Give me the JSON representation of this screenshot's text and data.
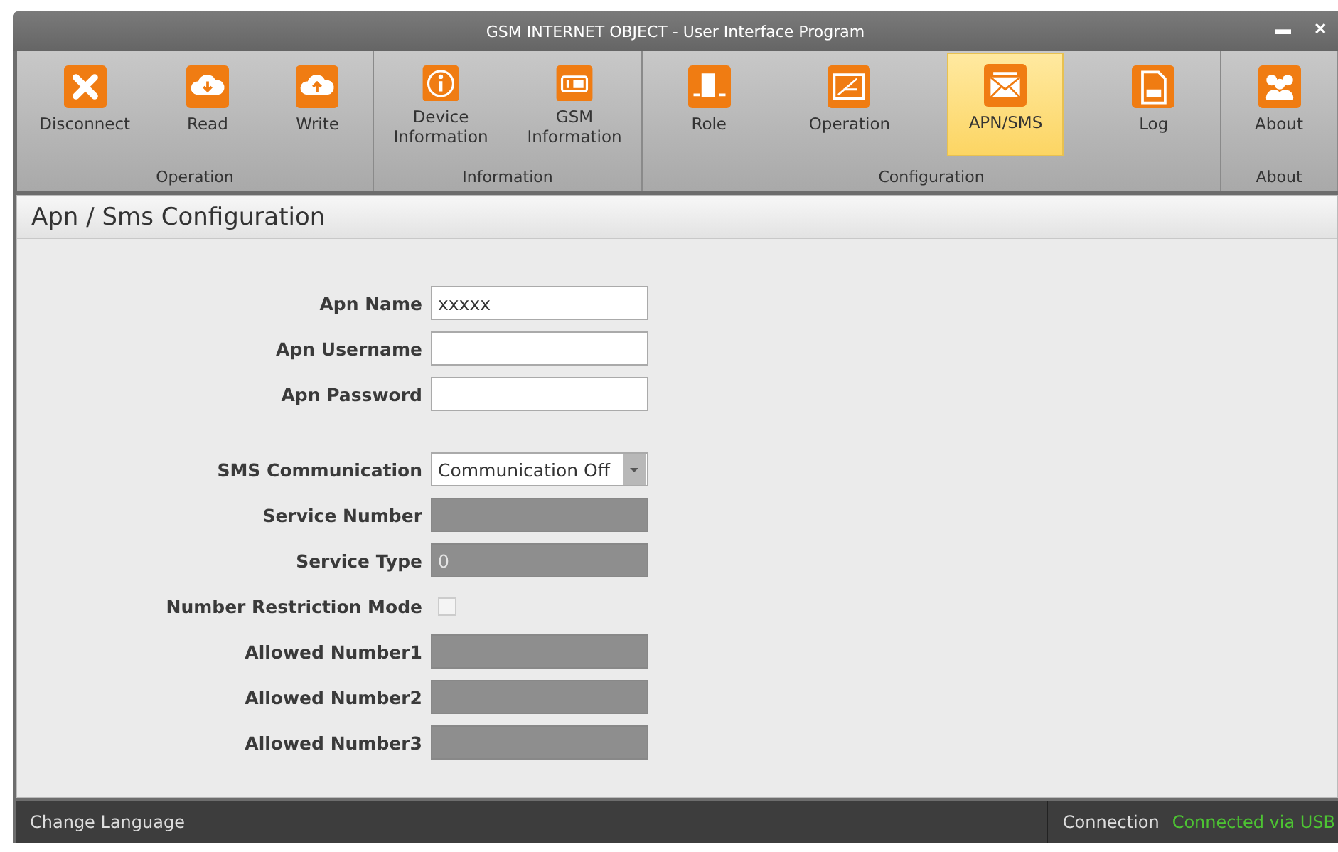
{
  "window": {
    "title": "GSM INTERNET OBJECT - User Interface Program",
    "controls": [
      "▬",
      "✕"
    ]
  },
  "ribbon": [
    {
      "group": "Operation",
      "buttons": [
        {
          "label": "Disconnect",
          "selected": false
        },
        {
          "label": "Read",
          "selected": false
        },
        {
          "label": "Write",
          "selected": false
        }
      ]
    },
    {
      "group": "Information",
      "buttons": [
        {
          "label": "Device\nInformation",
          "selected": false
        },
        {
          "label": "GSM\nInformation",
          "selected": false
        }
      ]
    },
    {
      "group": "Configuration",
      "buttons": [
        {
          "label": "Role",
          "selected": false
        },
        {
          "label": "Operation",
          "selected": false
        },
        {
          "label": "APN/SMS",
          "selected": true
        },
        {
          "label": "Log",
          "selected": false
        }
      ]
    },
    {
      "group": "About",
      "buttons": [
        {
          "label": "About",
          "selected": false
        }
      ]
    }
  ],
  "page_title": "Apn / Sms Configuration",
  "form": [
    {
      "kind": "text",
      "label": "Apn Name",
      "value": "xxxxx",
      "disabled": false
    },
    {
      "kind": "text",
      "label": "Apn Username",
      "disabled": false
    },
    {
      "kind": "text",
      "label": "Apn Password",
      "disabled": false
    },
    {
      "kind": "gap"
    },
    {
      "kind": "select",
      "label": "SMS Communication",
      "value": "Communication Off",
      "disabled": false
    },
    {
      "kind": "text",
      "label": "Service Number",
      "disabled": true
    },
    {
      "kind": "text",
      "label": "Service Type",
      "value": "0",
      "disabled": true
    },
    {
      "kind": "checkbox",
      "label": "Number Restriction Mode",
      "checked": false,
      "disabled": true
    },
    {
      "kind": "text",
      "label": "Allowed Number1",
      "disabled": true
    },
    {
      "kind": "text",
      "label": "Allowed Number2",
      "disabled": true
    },
    {
      "kind": "text",
      "label": "Allowed Number3",
      "disabled": true
    }
  ],
  "status_bar": {
    "language": "Change Language",
    "connection_label": "Connection",
    "connection_value": "Connected via USB"
  }
}
